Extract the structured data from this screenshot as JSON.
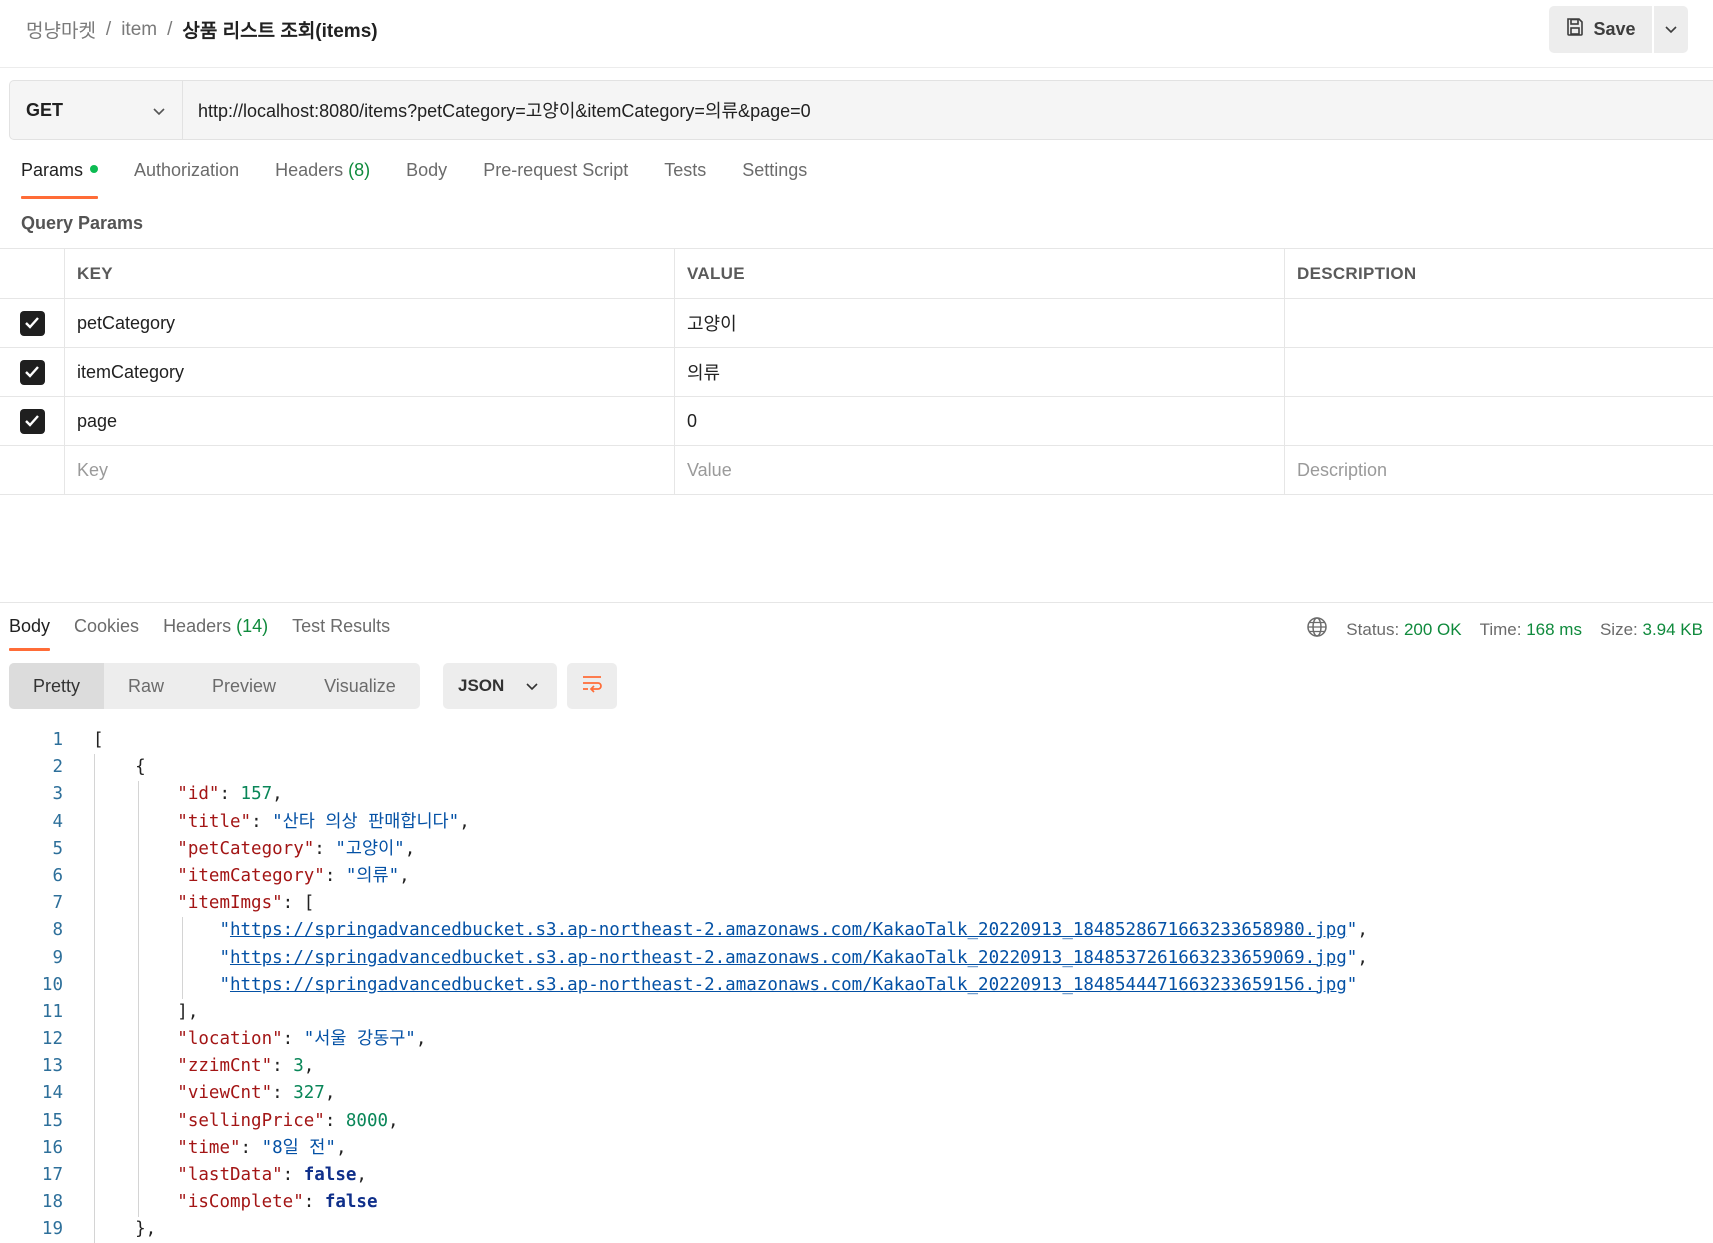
{
  "breadcrumb": {
    "workspace": "멍냥마켓",
    "collection": "item",
    "request": "상품 리스트 조회(items)",
    "separator": "/"
  },
  "save": {
    "label": "Save"
  },
  "request": {
    "method": "GET",
    "url": "http://localhost:8080/items?petCategory=고양이&itemCategory=의류&page=0"
  },
  "tabs": {
    "params": "Params",
    "authorization": "Authorization",
    "headers": "Headers",
    "headers_count": "(8)",
    "body": "Body",
    "prerequest": "Pre-request Script",
    "tests": "Tests",
    "settings": "Settings"
  },
  "query_params": {
    "label": "Query Params",
    "headers": {
      "key": "KEY",
      "value": "VALUE",
      "description": "DESCRIPTION"
    },
    "rows": [
      {
        "key": "petCategory",
        "value": "고양이",
        "description": "",
        "checked": true
      },
      {
        "key": "itemCategory",
        "value": "의류",
        "description": "",
        "checked": true
      },
      {
        "key": "page",
        "value": "0",
        "description": "",
        "checked": true
      }
    ],
    "placeholders": {
      "key": "Key",
      "value": "Value",
      "description": "Description"
    }
  },
  "response": {
    "tabs": {
      "body": "Body",
      "cookies": "Cookies",
      "headers": "Headers",
      "headers_count": "(14)",
      "test_results": "Test Results"
    },
    "status_label": "Status:",
    "status": "200 OK",
    "time_label": "Time:",
    "time": "168 ms",
    "size_label": "Size:",
    "size": "3.94 KB",
    "views": {
      "pretty": "Pretty",
      "raw": "Raw",
      "preview": "Preview",
      "visualize": "Visualize"
    },
    "format": "JSON",
    "body_lines": [
      "1",
      "2",
      "3",
      "4",
      "5",
      "6",
      "7",
      "8",
      "9",
      "10",
      "11",
      "12",
      "13",
      "14",
      "15",
      "16",
      "17",
      "18",
      "19"
    ],
    "json": {
      "id": "157",
      "title": "\"산타 의상 판매합니다\"",
      "petCategory": "\"고양이\"",
      "itemCategory": "\"의류\"",
      "img1": "https://springadvancedbucket.s3.ap-northeast-2.amazonaws.com/KakaoTalk_20220913_184852867166323365898​0.jpg",
      "img2": "https://springadvancedbucket.s3.ap-northeast-2.amazonaws.com/KakaoTalk_20220913_1848537261663233659069.jpg",
      "img3": "https://springadvancedbucket.s3.ap-northeast-2.amazonaws.com/KakaoTalk_20220913_1848544471663233659156.jpg",
      "location": "\"서울 강동구\"",
      "zzimCnt": "3",
      "viewCnt": "327",
      "sellingPrice": "8000",
      "time": "\"8일 전\"",
      "lastData": "false",
      "isComplete": "false"
    }
  },
  "colors": {
    "accent": "#ff6c37",
    "success": "#0f8a3c",
    "checkbox": "#1f1f1f"
  }
}
